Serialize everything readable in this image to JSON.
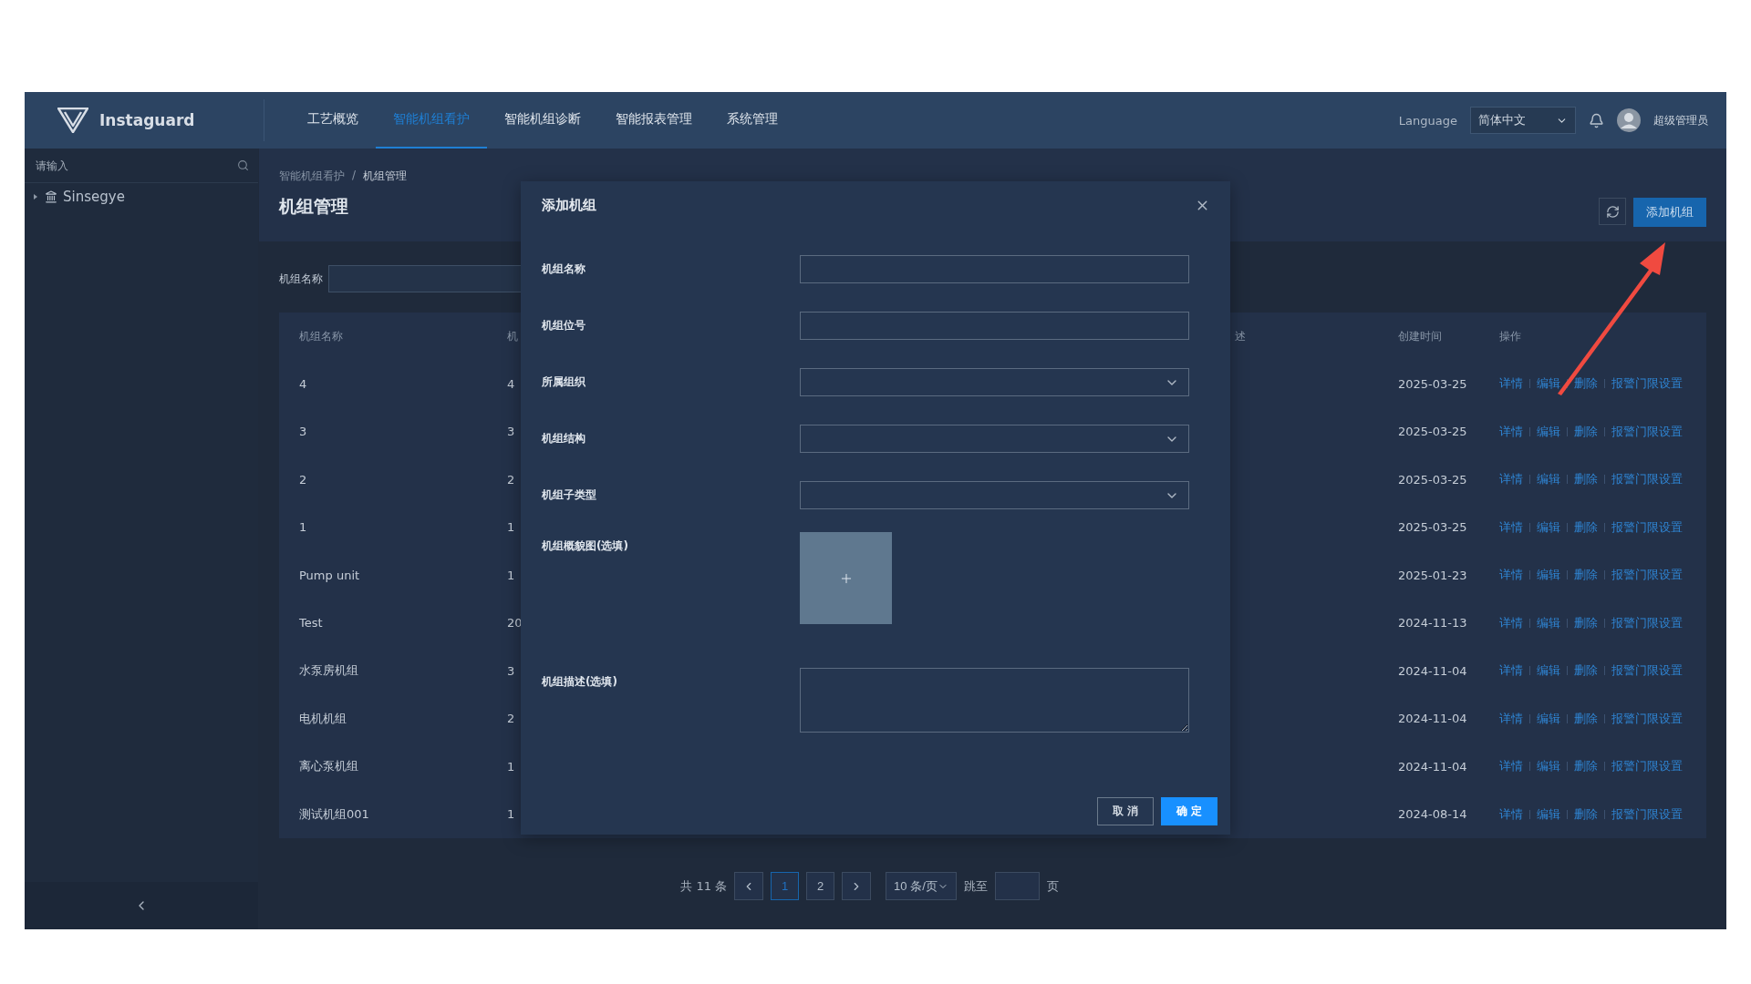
{
  "header": {
    "logo": "Instaguard",
    "nav": [
      {
        "label": "工艺概览",
        "selected": false
      },
      {
        "label": "智能机组看护",
        "selected": true
      },
      {
        "label": "智能机组诊断",
        "selected": false
      },
      {
        "label": "智能报表管理",
        "selected": false
      },
      {
        "label": "系统管理",
        "selected": false
      }
    ],
    "language_label": "Language",
    "language": "简体中文",
    "user": "超级管理员"
  },
  "sidebar": {
    "search": {
      "placeholder": "请输入"
    },
    "tree": [
      {
        "label": "Sinsegye",
        "expanded": false
      }
    ]
  },
  "breadcrumb": [
    "智能机组看护",
    "机组管理"
  ],
  "breadcrumb_separator": "/",
  "page_title": "机组管理",
  "add_button": "添加机组",
  "filter": {
    "label": "机组名称"
  },
  "table": {
    "columns": [
      "机组名称",
      "机",
      "述",
      "创建时间",
      "操作"
    ],
    "rows": [
      {
        "name": "4",
        "column_2": "4",
        "created": "2025-03-25",
        "actions": [
          "详情",
          "编辑",
          "删除",
          "报警门限设置"
        ]
      },
      {
        "name": "3",
        "column_2": "3",
        "created": "2025-03-25",
        "actions": [
          "详情",
          "编辑",
          "删除",
          "报警门限设置"
        ]
      },
      {
        "name": "2",
        "column_2": "2",
        "created": "2025-03-25",
        "actions": [
          "详情",
          "编辑",
          "删除",
          "报警门限设置"
        ]
      },
      {
        "name": "1",
        "column_2": "1",
        "created": "2025-03-25",
        "actions": [
          "详情",
          "编辑",
          "删除",
          "报警门限设置"
        ]
      },
      {
        "name": "Pump unit",
        "column_2": "1",
        "created": "2025-01-23",
        "actions": [
          "详情",
          "编辑",
          "删除",
          "报警门限设置"
        ]
      },
      {
        "name": "Test",
        "column_2": "20",
        "created": "2024-11-13",
        "actions": [
          "详情",
          "编辑",
          "删除",
          "报警门限设置"
        ]
      },
      {
        "name": "水泵房机组",
        "column_2": "3",
        "created": "2024-11-04",
        "actions": [
          "详情",
          "编辑",
          "删除",
          "报警门限设置"
        ]
      },
      {
        "name": "电机机组",
        "column_2": "2",
        "created": "2024-11-04",
        "actions": [
          "详情",
          "编辑",
          "删除",
          "报警门限设置"
        ]
      },
      {
        "name": "离心泵机组",
        "column_2": "1",
        "created": "2024-11-04",
        "actions": [
          "详情",
          "编辑",
          "删除",
          "报警门限设置"
        ]
      },
      {
        "name": "测试机组001",
        "column_2": "1",
        "created": "2024-08-14",
        "actions": [
          "详情",
          "编辑",
          "删除",
          "报警门限设置"
        ]
      }
    ]
  },
  "pagination": {
    "total": "共 11 条",
    "pages": [
      {
        "label": "1",
        "selected": true
      },
      {
        "label": "2",
        "selected": false
      }
    ],
    "page_size": "10 条/页",
    "jump_label": "跳至",
    "page_suffix": "页"
  },
  "dialog": {
    "title": "添加机组",
    "fields": [
      {
        "label": "机组名称",
        "kind": "text"
      },
      {
        "label": "机组位号",
        "kind": "text"
      },
      {
        "label": "所属组织",
        "kind": "select"
      },
      {
        "label": "机组结构",
        "kind": "select"
      },
      {
        "label": "机组子类型",
        "kind": "select"
      },
      {
        "label": "机组概貌图(选填)",
        "kind": "upload"
      },
      {
        "label": "机组描述(选填)",
        "kind": "textarea"
      }
    ],
    "buttons": [
      {
        "label": "取 消",
        "kind": "secondary"
      },
      {
        "label": "确 定",
        "kind": "primary"
      }
    ]
  }
}
